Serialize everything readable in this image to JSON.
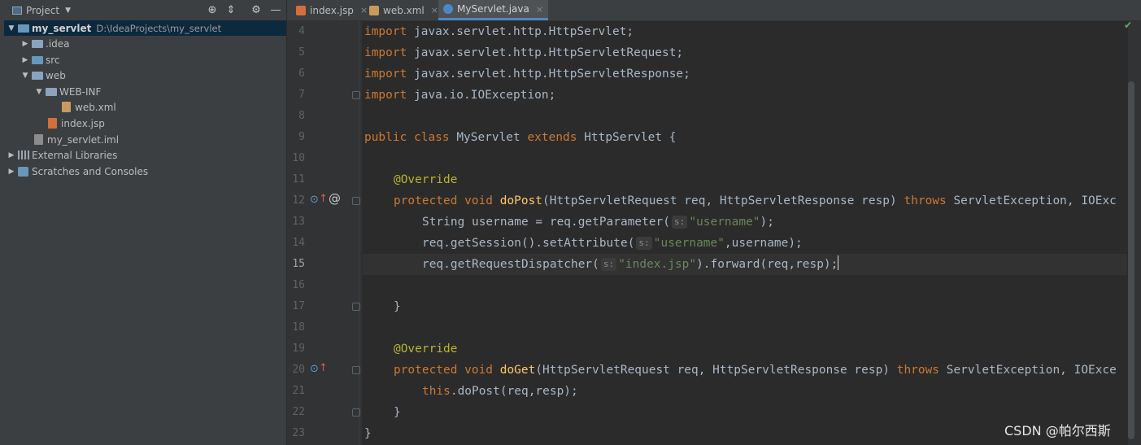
{
  "project_panel": {
    "title": "Project",
    "tree": [
      {
        "label": "my_servlet",
        "path": "D:\\IdeaProjects\\my_servlet",
        "icon": "module-folder-icon",
        "expanded": true
      },
      {
        "label": ".idea",
        "icon": "folder-icon"
      },
      {
        "label": "src",
        "icon": "source-folder-icon"
      },
      {
        "label": "web",
        "icon": "web-folder-icon"
      },
      {
        "label": "WEB-INF",
        "icon": "folder-icon"
      },
      {
        "label": "web.xml",
        "icon": "xml-file-icon"
      },
      {
        "label": "index.jsp",
        "icon": "jsp-file-icon"
      },
      {
        "label": "my_servlet.iml",
        "icon": "iml-file-icon"
      },
      {
        "label": "External Libraries",
        "icon": "library-icon"
      },
      {
        "label": "Scratches and Consoles",
        "icon": "scratch-icon"
      }
    ]
  },
  "tabs": [
    {
      "label": "index.jsp",
      "icon": "jsp-file-icon",
      "active": false
    },
    {
      "label": "web.xml",
      "icon": "xml-file-icon",
      "active": false
    },
    {
      "label": "MyServlet.java",
      "icon": "java-class-icon",
      "active": true
    }
  ],
  "tab_close_glyph": "×",
  "editor": {
    "line_numbers": [
      "4",
      "5",
      "6",
      "7",
      "8",
      "9",
      "10",
      "11",
      "12",
      "13",
      "14",
      "15",
      "16",
      "17",
      "18",
      "19",
      "20",
      "21",
      "22",
      "23"
    ],
    "current_line": "15",
    "param_hint": "s:",
    "tokens": {
      "import": "import",
      "l4": "javax.servlet.http.HttpServlet;",
      "l5": "javax.servlet.http.HttpServletRequest;",
      "l6": "javax.servlet.http.HttpServletResponse;",
      "l7": "java.io.IOException;",
      "public": "public",
      "class": "class",
      "class_name": "MyServlet",
      "extends": "extends",
      "super": "HttpServlet {",
      "override": "@Override",
      "protected": "protected",
      "void": "void",
      "doPost": "doPost",
      "doPost_params": "(HttpServletRequest req, HttpServletResponse resp)",
      "throws": "throws",
      "doPost_exc": "ServletException, IOExc",
      "l13a": "String username = req.getParameter(",
      "l13s": "\"username\"",
      "l13b": ");",
      "l14a": "req.getSession().setAttribute(",
      "l14s": "\"username\"",
      "l14b": ",username);",
      "l15a": "req.getRequestDispatcher(",
      "l15s": "\"index.jsp\"",
      "l15b": ").forward(req,resp);",
      "close_brace": "}",
      "doGet": "doGet",
      "doGet_params": "(HttpServletRequest req, HttpServletResponse resp)",
      "doGet_exc": "ServletException, IOExce",
      "this": "this",
      "l21b": ".doPost(req,resp);"
    }
  },
  "watermark": "CSDN @帕尔西斯",
  "colors": {
    "keyword": "#cc7832",
    "annotation": "#bbb529",
    "string": "#6a8759",
    "method": "#ffc66d",
    "text": "#a9b7c6",
    "background": "#2b2b2b"
  }
}
